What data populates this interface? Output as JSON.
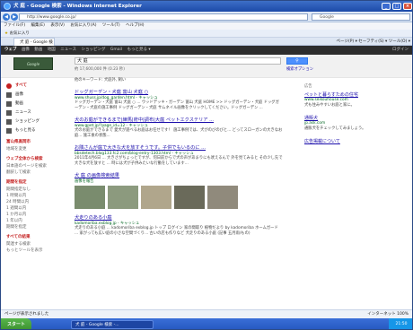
{
  "window": {
    "title": "犬 庭 - Google 検索 - Windows Internet Explorer",
    "address": "http://www.google.co.jp/",
    "search_box": "Google",
    "menu": [
      "ファイル(F)",
      "編集(E)",
      "表示(V)",
      "お気に入り(A)",
      "ツール(T)",
      "ヘルプ(H)"
    ],
    "favorites": "お気に入り",
    "tab_label": "犬 庭 - Google 検索",
    "commands": "ページ(P) ▾  セーフティ(S) ▾  ツール(O) ▾"
  },
  "gbar": {
    "items": [
      "ウェブ",
      "画像",
      "動画",
      "地図",
      "ニュース",
      "ショッピング",
      "Gmail",
      "もっと見る ▾"
    ],
    "right": "ログイン"
  },
  "search": {
    "query": "犬 庭",
    "button": "検索",
    "count": "約 17,600,000 件 (0.23 秒)",
    "options": "検索オプション"
  },
  "left": {
    "nav": [
      "すべて",
      "画像",
      "動画",
      "ニュース",
      "ショッピング",
      "もっと見る"
    ],
    "loc_title": "富山県高岡市",
    "loc_sub": "地域を変更",
    "web_title": "ウェブ全体から検索",
    "web_opts": [
      "日本語のページを検索",
      "翻訳して検索"
    ],
    "period_title": "期間を指定",
    "periods": [
      "期間指定なし",
      "1 時間以内",
      "24 時間以内",
      "1 週間以内",
      "1 か月以内",
      "1 年以内",
      "期間を指定"
    ],
    "all_title": "すべての結果",
    "all_opts": [
      "関連する検索",
      "もっとツールを表示"
    ]
  },
  "related": "他のキーワード:  犬庭外, 飼い",
  "results": [
    {
      "title": "ドッグガーデン・犬庭 富山 犬庭 ○",
      "url": "www.shuss.jp/dog_garden.html - キャッシュ",
      "snippet": "ドッグガーデン・犬庭 富山 犬庭 ○ ... ウッドデッキ・ガーデン 富山 犬庭 HOME >> ドッグガーデン・犬庭 ドッグガーデン・犬庭の施工事例 ドッグガーデン・犬庭 サムネイル画像をクリックしてください。ドッグガーデン ..."
    },
    {
      "title": "犬のお庭ができるまで|練馬|府中|調布|大庭 ペットエクステリア ...",
      "url": "www.gpet.jp/?page_id=12 - キャッシュ",
      "snippet": "犬のお庭ができるまで 愛犬が遊べるお庭はお任せです！ 施工事例では、犬がのびのびと... どってスローガンの大きなお庭... 施工後の状態..."
    },
    {
      "title": "お隣さんが庭で大きな犬を放すそうです。子供でもいるのに ...",
      "url": "bbsdetech.blog133.fc2.com/blog-entry-1303.html - キャッシュ",
      "snippet": "2011年4月6日 ... 大きさがちょっとですが、何日前からで犬の声があまりにも吠えるんで 外を見てみると その少し先で大きな犬を放すと ... 時には犬が子供みたいな行動をしています..."
    },
    {
      "title": "犬 庭 の画像検索結果",
      "url": "画像を報告",
      "snippet": ""
    },
    {
      "title": "犬走りのある小庭",
      "url": "kadomoriba.exblog.jp - キャッシュ",
      "snippet": "犬走りのある小庭 ... kadomoriba exblog.jp トップ ログイン 家の間取り 植物だより by kadomoriba ホームガード ... 家がっても広い庭の小さな空間づくり... 古いの店も作りなど 犬走りのある小庭 (記事 五月雨/もの)"
    }
  ],
  "ads": {
    "label": "広告",
    "items": [
      {
        "title": "ペットと暮らすための住宅",
        "url": "www.seikouhouse.com",
        "snippet": "犬も住みやすいお庭と家に。"
      },
      {
        "title": "通販犬",
        "url": "jp.ask.com",
        "snippet": "通販犬をチェックしてみましょう。"
      }
    ],
    "more": "広告掲載について"
  },
  "status": {
    "left": "ページが表示されました",
    "right": "インターネット    100%"
  },
  "taskbar": {
    "start": "スタート",
    "task": "犬 庭 - Google 検索 -...",
    "clock": "21:50"
  }
}
